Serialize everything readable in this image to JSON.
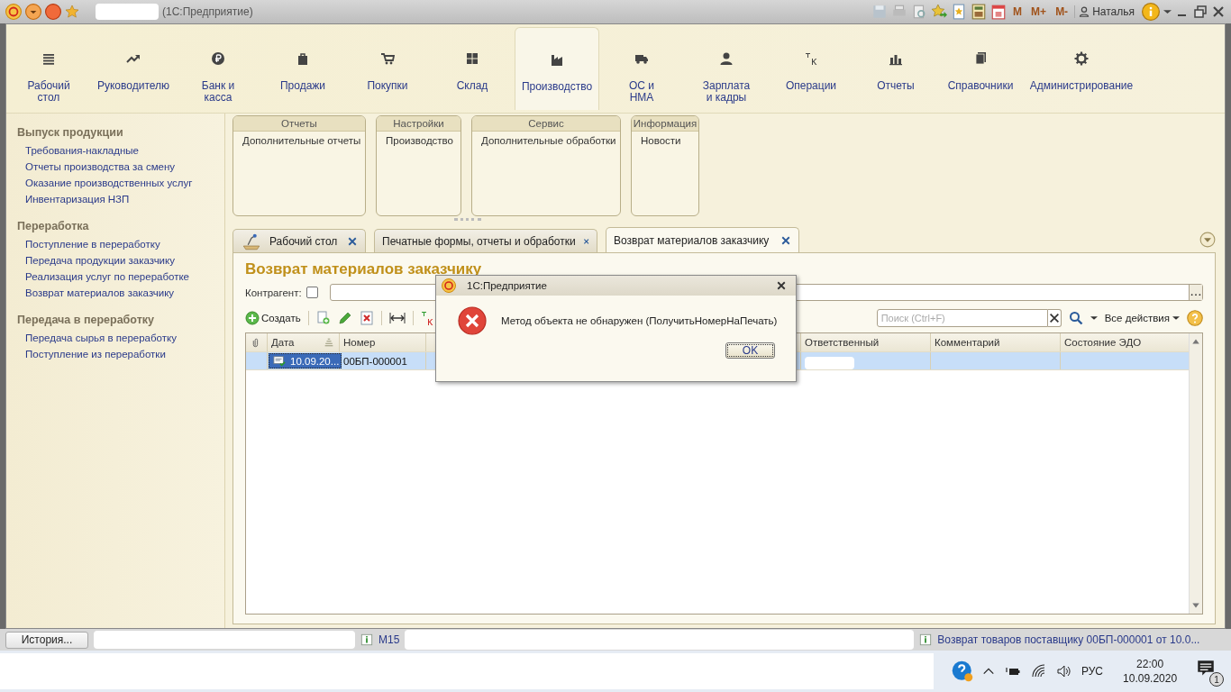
{
  "window": {
    "title": "(1С:Предприятие)",
    "memory_buttons": [
      "M",
      "M+",
      "M-"
    ],
    "user": "Наталья"
  },
  "sections": [
    {
      "label": "Рабочий\nстол",
      "selected": false
    },
    {
      "label": "Руководителю",
      "selected": false
    },
    {
      "label": "Банк и\nкасса",
      "selected": false
    },
    {
      "label": "Продажи",
      "selected": false
    },
    {
      "label": "Покупки",
      "selected": false
    },
    {
      "label": "Склад",
      "selected": false
    },
    {
      "label": "Производство",
      "selected": true
    },
    {
      "label": "ОС и\nНМА",
      "selected": false
    },
    {
      "label": "Зарплата\nи кадры",
      "selected": false
    },
    {
      "label": "Операции",
      "selected": false
    },
    {
      "label": "Отчеты",
      "selected": false
    },
    {
      "label": "Справочники",
      "selected": false
    },
    {
      "label": "Администрирование",
      "selected": false
    }
  ],
  "navigation": [
    {
      "title": "Выпуск продукции",
      "items": [
        "Требования-накладные",
        "Отчеты производства за смену",
        "Оказание производственных услуг",
        "Инвентаризация НЗП"
      ]
    },
    {
      "title": "Переработка",
      "items": [
        "Поступление в переработку",
        "Передача продукции заказчику",
        "Реализация услуг по переработке",
        "Возврат материалов заказчику"
      ]
    },
    {
      "title": "Передача в переработку",
      "items": [
        "Передача сырья в переработку",
        "Поступление из переработки"
      ]
    }
  ],
  "function_panel": [
    {
      "title": "Отчеты",
      "items": [
        "Дополнительные отчеты"
      ]
    },
    {
      "title": "Настройки",
      "items": [
        "Производство"
      ]
    },
    {
      "title": "Сервис",
      "items": [
        "Дополнительные обработки"
      ]
    },
    {
      "title": "Информация",
      "items": [
        "Новости"
      ]
    }
  ],
  "tabs": [
    {
      "label": "Рабочий стол",
      "selected": false,
      "kind": "home"
    },
    {
      "label": "Печатные формы, отчеты и обработки",
      "selected": false,
      "kind": "form"
    },
    {
      "label": "Возврат материалов заказчику",
      "selected": true,
      "kind": "form"
    }
  ],
  "form": {
    "title": "Возврат материалов заказчику",
    "filter_label": "Контрагент:",
    "filter_checked": false,
    "create_button": "Создать",
    "search": {
      "placeholder": "Поиск (Ctrl+F)"
    },
    "all_actions": "Все действия",
    "table": {
      "columns": [
        {
          "label": "Дата",
          "sorted": true
        },
        {
          "label": "Номер",
          "sorted": false
        },
        {
          "label": "Ответственный",
          "sorted": false
        },
        {
          "label": "Комментарий",
          "sorted": false
        },
        {
          "label": "Состояние ЭДО",
          "sorted": false
        }
      ],
      "rows": [
        {
          "date": "10.09.20...",
          "number": "00БП-000001",
          "selected": true
        }
      ]
    }
  },
  "dialog": {
    "title": "1С:Предприятие",
    "message": "Метод объекта не обнаружен (ПолучитьНомерНаПечать)",
    "button": "OK"
  },
  "status_bar": {
    "history_button": "История...",
    "messages": [
      "М15",
      "Возврат товаров поставщику 00БП-000001 от 10.0..."
    ]
  },
  "taskbar": {
    "language": "РУС",
    "time": "22:00",
    "date": "10.09.2020",
    "notifications": "1"
  }
}
